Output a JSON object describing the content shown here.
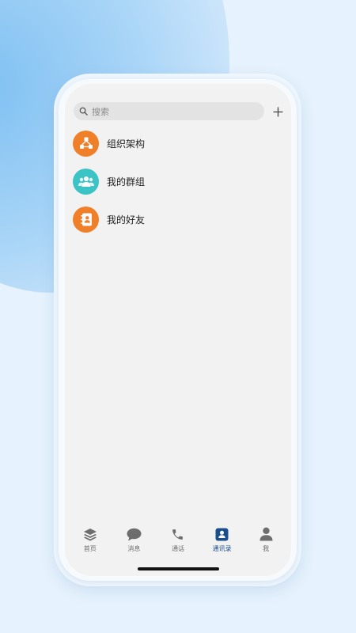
{
  "search": {
    "placeholder": "搜索"
  },
  "contacts": {
    "items": [
      {
        "label": "组织架构",
        "icon": "org-chart-icon",
        "color": "#f07f2a"
      },
      {
        "label": "我的群组",
        "icon": "group-icon",
        "color": "#3cc3c6"
      },
      {
        "label": "我的好友",
        "icon": "contact-book-icon",
        "color": "#f07f2a"
      }
    ]
  },
  "tabbar": {
    "tabs": [
      {
        "label": "首页",
        "icon": "layers-icon",
        "active": false
      },
      {
        "label": "消息",
        "icon": "chat-bubble-icon",
        "active": false
      },
      {
        "label": "通话",
        "icon": "phone-icon",
        "active": false
      },
      {
        "label": "通讯录",
        "icon": "address-book-icon",
        "active": true
      },
      {
        "label": "我",
        "icon": "person-icon",
        "active": false
      }
    ],
    "active_color": "#1b4f8c",
    "inactive_color": "#6d6d6d"
  }
}
